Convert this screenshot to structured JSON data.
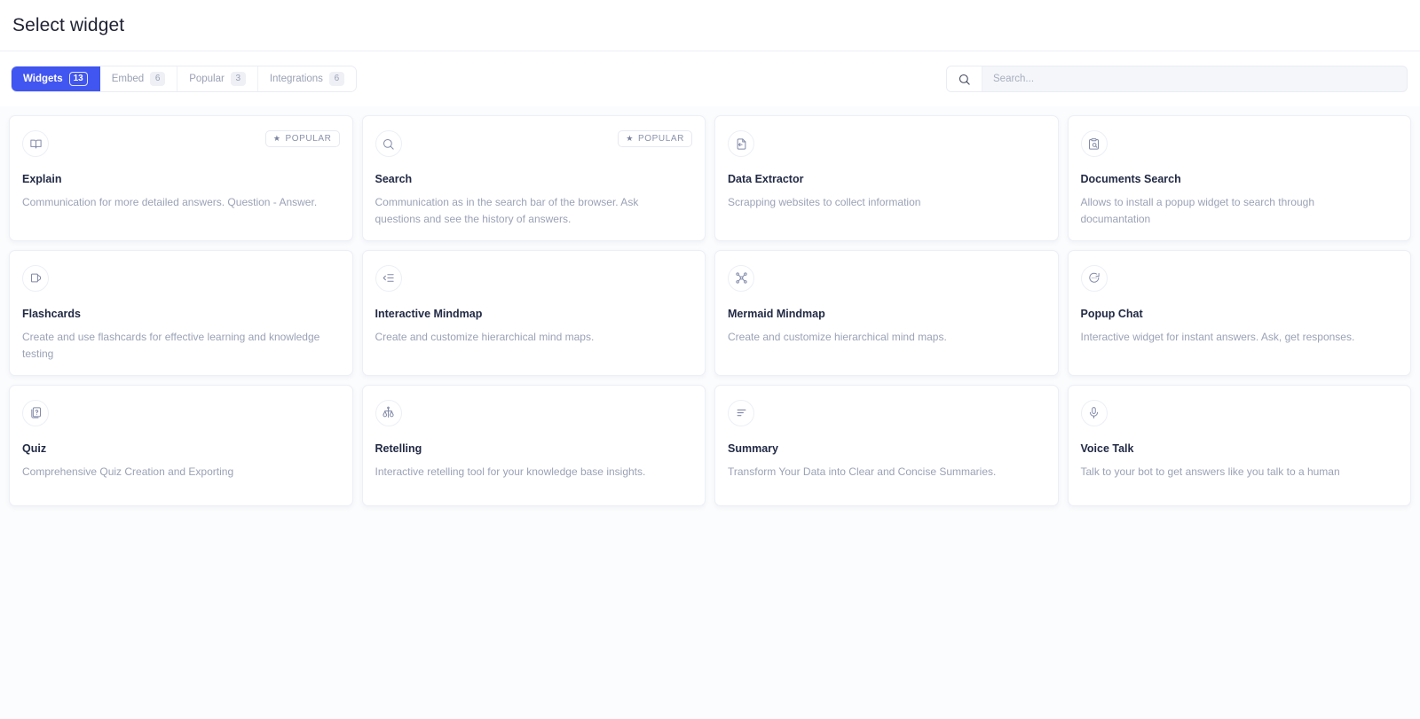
{
  "header": {
    "title": "Select widget"
  },
  "toolbar": {
    "tabs": [
      {
        "label": "Widgets",
        "count": "13",
        "active": true
      },
      {
        "label": "Embed",
        "count": "6",
        "active": false
      },
      {
        "label": "Popular",
        "count": "3",
        "active": false
      },
      {
        "label": "Integrations",
        "count": "6",
        "active": false
      }
    ],
    "search": {
      "icon": "search-icon",
      "placeholder": "Search...",
      "value": ""
    }
  },
  "badges": {
    "popular_label": "POPULAR",
    "star_glyph": "★"
  },
  "colors": {
    "accent": "#4155f1",
    "page_background": "#fbfcfd",
    "card_background": "#ffffff",
    "title_text": "#222a45",
    "muted_text": "#9ba2b6",
    "border": "#eceff5"
  },
  "cards": [
    {
      "title": "Explain",
      "description": "Communication for more detailed answers. Question - Answer.",
      "icon": "open-book-icon",
      "popular": true
    },
    {
      "title": "Search",
      "description": "Communication as in the search bar of the browser. Ask questions and see the history of answers.",
      "icon": "magnifier-icon",
      "popular": true
    },
    {
      "title": "Data Extractor",
      "description": "Scrapping websites to collect information",
      "icon": "file-extract-icon",
      "popular": false
    },
    {
      "title": "Documents Search",
      "description": "Allows to install a popup widget to search through documantation",
      "icon": "document-search-icon",
      "popular": false
    },
    {
      "title": "Flashcards",
      "description": "Create and use flashcards for effective learning and knowledge testing",
      "icon": "flashcard-icon",
      "popular": false
    },
    {
      "title": "Interactive Mindmap",
      "description": "Create and customize hierarchical mind maps.",
      "icon": "indent-list-icon",
      "popular": false
    },
    {
      "title": "Mermaid Mindmap",
      "description": "Create and customize hierarchical mind maps.",
      "icon": "network-nodes-icon",
      "popular": false
    },
    {
      "title": "Popup Chat",
      "description": "Interactive widget for instant answers. Ask, get responses.",
      "icon": "chat-bubble-icon",
      "popular": false
    },
    {
      "title": "Quiz",
      "description": "Comprehensive Quiz Creation and Exporting",
      "icon": "quiz-question-icon",
      "popular": false
    },
    {
      "title": "Retelling",
      "description": "Interactive retelling tool for your knowledge base insights.",
      "icon": "scales-icon",
      "popular": false
    },
    {
      "title": "Summary",
      "description": "Transform Your Data into Clear and Concise Summaries.",
      "icon": "text-lines-icon",
      "popular": false
    },
    {
      "title": "Voice Talk",
      "description": "Talk to your bot to get answers like you talk to a human",
      "icon": "microphone-icon",
      "popular": false
    }
  ]
}
